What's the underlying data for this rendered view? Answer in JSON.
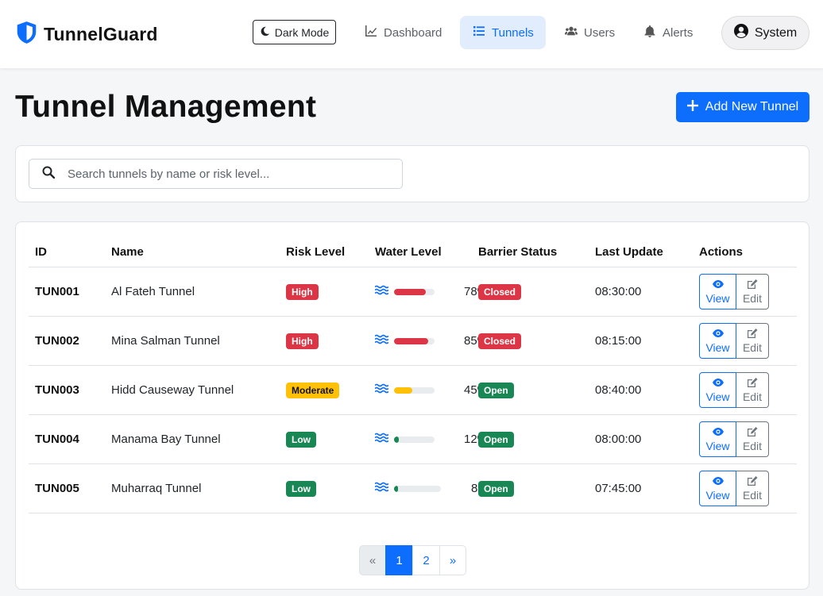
{
  "brand": {
    "name": "TunnelGuard"
  },
  "dark_mode_label": "Dark Mode",
  "nav": [
    {
      "label": "Dashboard",
      "icon": "chart-line-icon",
      "active": false
    },
    {
      "label": "Tunnels",
      "icon": "list-icon",
      "active": true
    },
    {
      "label": "Users",
      "icon": "users-icon",
      "active": false
    },
    {
      "label": "Alerts",
      "icon": "bell-icon",
      "active": false
    }
  ],
  "user_menu": {
    "label": "System",
    "icon": "user-circle-icon"
  },
  "page": {
    "title": "Tunnel Management",
    "add_button": "Add New Tunnel"
  },
  "search": {
    "placeholder": "Search tunnels by name or risk level...",
    "value": ""
  },
  "table": {
    "headers": [
      "ID",
      "Name",
      "Risk Level",
      "Water Level",
      "Barrier Status",
      "Last Update",
      "Actions"
    ],
    "view_label": "View",
    "edit_label": "Edit",
    "rows": [
      {
        "id": "TUN001",
        "name": "Al Fateh Tunnel",
        "risk": "High",
        "water_pct": 78,
        "water": "78%",
        "barrier": "Closed",
        "updated": "08:30:00"
      },
      {
        "id": "TUN002",
        "name": "Mina Salman Tunnel",
        "risk": "High",
        "water_pct": 85,
        "water": "85%",
        "barrier": "Closed",
        "updated": "08:15:00"
      },
      {
        "id": "TUN003",
        "name": "Hidd Causeway Tunnel",
        "risk": "Moderate",
        "water_pct": 45,
        "water": "45%",
        "barrier": "Open",
        "updated": "08:40:00"
      },
      {
        "id": "TUN004",
        "name": "Manama Bay Tunnel",
        "risk": "Low",
        "water_pct": 12,
        "water": "12%",
        "barrier": "Open",
        "updated": "08:00:00"
      },
      {
        "id": "TUN005",
        "name": "Muharraq Tunnel",
        "risk": "Low",
        "water_pct": 8,
        "water": "8%",
        "barrier": "Open",
        "updated": "07:45:00"
      }
    ]
  },
  "pagination": {
    "prev": "«",
    "pages": [
      "1",
      "2"
    ],
    "current": "1",
    "next": "»"
  },
  "colors": {
    "primary": "#0d6efd",
    "danger": "#dc3545",
    "warning": "#ffc107",
    "success": "#198754"
  }
}
